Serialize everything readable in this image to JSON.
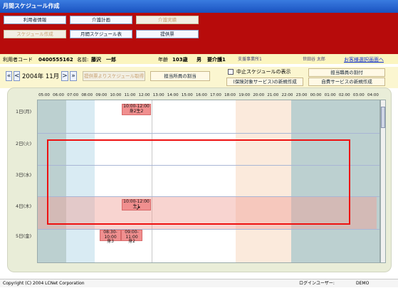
{
  "window": {
    "title": "月間スケジュール作成"
  },
  "menu_row1": [
    {
      "label": "利用者情報"
    },
    {
      "label": "介護計画"
    },
    {
      "label": "介護実績"
    }
  ],
  "menu_row2": [
    {
      "label": "スケジュール作成"
    },
    {
      "label": "月間スケジュール表"
    },
    {
      "label": "提供票"
    }
  ],
  "info": {
    "user_code_label": "利用者コード",
    "user_code": "0400555162",
    "name_label": "名前:",
    "name": "藤沢　一郎",
    "age_label": "年齢",
    "age": "103歳",
    "gender": "男",
    "care_level": "要介護1",
    "office": "支援事業所1",
    "staff": "世田谷 太郎",
    "customer_link": "お客様選択画面へ"
  },
  "controls": {
    "year_month": "2004年 11月",
    "get_from_slip": "提供票よりスケジュール取得",
    "assign_staff": "担当所員の割当",
    "show_cancelled": "中止スケジュールの表示",
    "assign_charge_staff": "担当職員の割付",
    "new_insured_service": "(保険対象サービス)の新規作成",
    "new_private_service": "自費サービスの新規作成"
  },
  "schedule": {
    "times": [
      "05:00",
      "06:00",
      "07:00",
      "08:00",
      "09:00",
      "10:00",
      "11:00",
      "12:00",
      "13:00",
      "14:00",
      "15:00",
      "16:00",
      "17:00",
      "18:00",
      "19:00",
      "20:00",
      "21:00",
      "22:00",
      "23:00",
      "00:00",
      "01:00",
      "02:00",
      "03:00",
      "04:00"
    ],
    "days": [
      "1日(月)",
      "2日(火)",
      "3日(水)",
      "4日(木)",
      "5日(金)"
    ],
    "events": [
      {
        "day": 0,
        "time": "10:00-12:00",
        "type": "身2生2"
      },
      {
        "day": 3,
        "time": "10:00-12:00",
        "type": "生1"
      },
      {
        "day": 4,
        "time": "08:30-10:00",
        "type": "身3"
      },
      {
        "day": 4,
        "time": "09:00-11:00",
        "type": "身2"
      }
    ]
  },
  "status": {
    "copyright": "Copyright (C) 2004 LCNet Corporation",
    "login_label": "ログインユーザー:",
    "login_user": "DEMO"
  },
  "colors": {
    "header_red": "#b70b0b",
    "event_fill": "#f08f8f",
    "highlight_row": "#f6c8c0"
  }
}
